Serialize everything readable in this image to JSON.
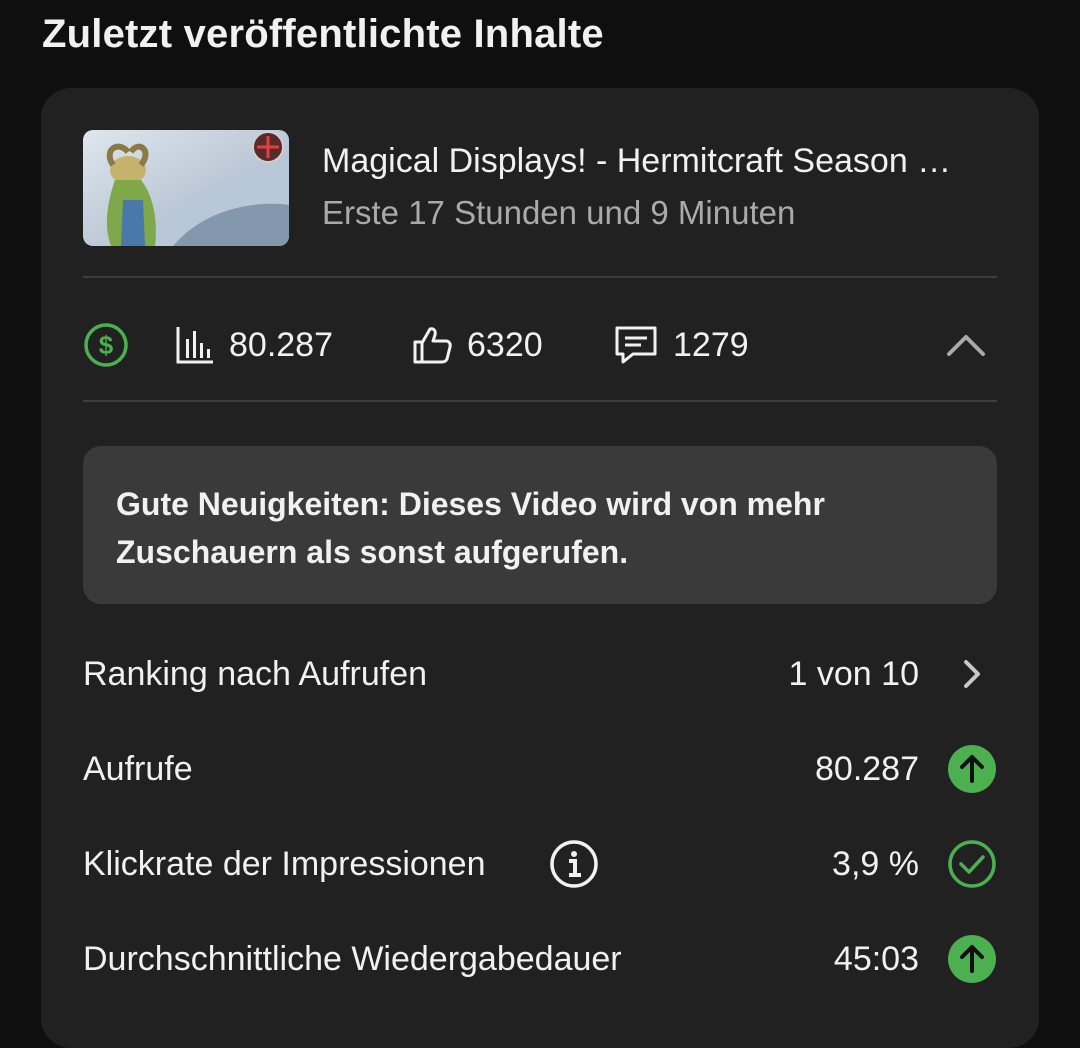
{
  "section": {
    "title": "Zuletzt veröffentlichte Inhalte"
  },
  "video": {
    "title": "Magical Displays! - Hermitcraft Season …",
    "subtitle": "Erste 17 Stunden und 9 Minuten",
    "thumbnail_icon": "video-thumbnail"
  },
  "stats": {
    "monetization_icon": "dollar-circle-icon",
    "views": "80.287",
    "likes": "6320",
    "comments": "1279",
    "collapse_icon": "chevron-up-icon"
  },
  "notice": {
    "text": "Gute Neuigkeiten: Dieses Video wird von mehr Zuschauern als sonst aufgerufen."
  },
  "metrics": [
    {
      "label": "Ranking nach Aufrufen",
      "value": "1 von 10",
      "icon": "chevron-right-icon"
    },
    {
      "label": "Aufrufe",
      "value": "80.287",
      "icon": "arrow-up-circle-icon"
    },
    {
      "label": "Klickrate der Impressionen",
      "value": "3,9 %",
      "icon": "check-circle-icon"
    },
    {
      "label": "Durchschnittliche Wiedergabedauer",
      "value": "45:03",
      "icon": "arrow-up-circle-icon"
    }
  ],
  "colors": {
    "background": "#0f0f0f",
    "card": "#212121",
    "notice": "#3a3a3a",
    "accent_green": "#4caf50",
    "text_primary": "#f1f1f1",
    "text_secondary": "#aaaaaa"
  }
}
